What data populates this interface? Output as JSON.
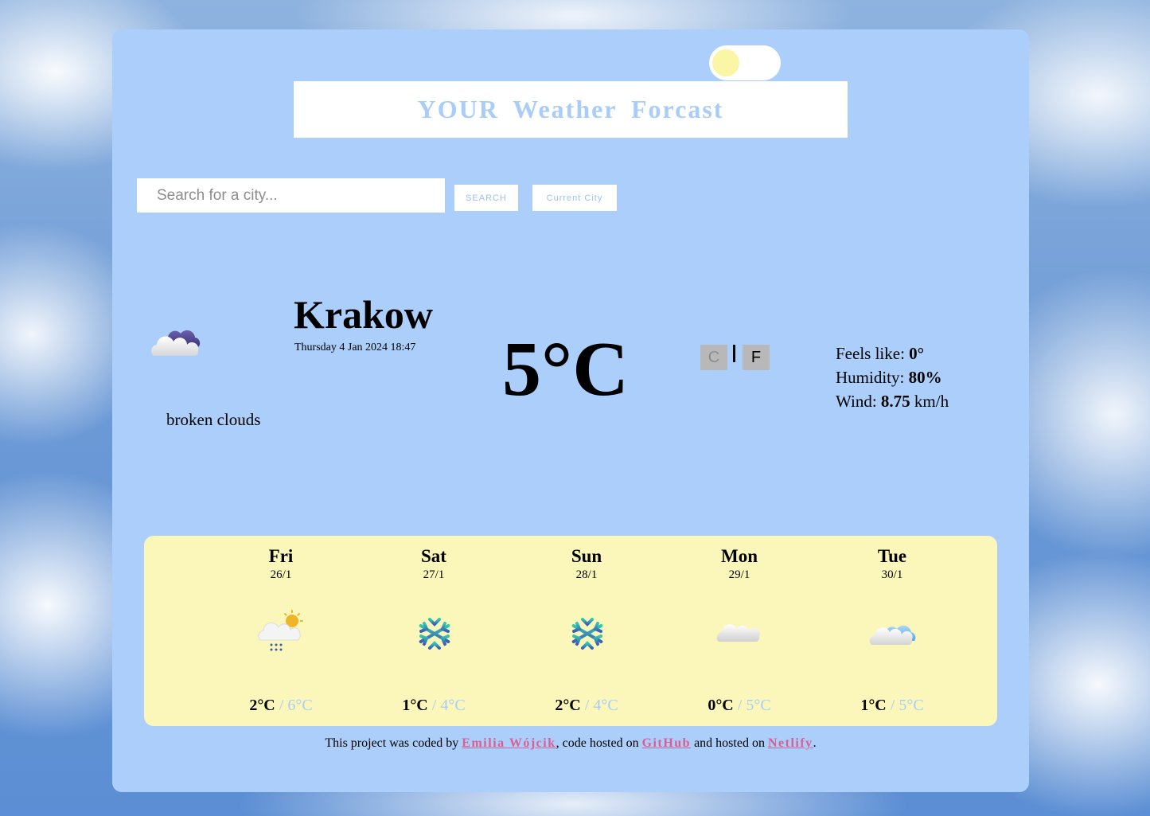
{
  "header": {
    "title": "YOUR  Weather  Forcast"
  },
  "search": {
    "placeholder": "Search for a city...",
    "search_label": "SEARCH",
    "current_city_label": "Current City"
  },
  "current": {
    "icon": "broken-clouds-icon",
    "description": "broken clouds",
    "city": "Krakow",
    "datetime": "Thursday 4 Jan 2024 18:47",
    "temperature": "5°C",
    "unit_c": "C",
    "unit_f": "F",
    "feels_label": "Feels like: ",
    "feels_value": "0°",
    "humidity_label": "Humidity: ",
    "humidity_value": "80%",
    "wind_label": "Wind: ",
    "wind_value": "8.75",
    "wind_unit": " km/h"
  },
  "forecast": [
    {
      "day": "Fri",
      "date": "26/1",
      "icon": "rain-sun-icon",
      "min": "2°C",
      "sep": " / ",
      "max": "6°C"
    },
    {
      "day": "Sat",
      "date": "27/1",
      "icon": "snowflake-icon",
      "min": "1°C",
      "sep": " / ",
      "max": "4°C"
    },
    {
      "day": "Sun",
      "date": "28/1",
      "icon": "snowflake-icon",
      "min": "2°C",
      "sep": " / ",
      "max": "4°C"
    },
    {
      "day": "Mon",
      "date": "29/1",
      "icon": "cloud-icon",
      "min": "0°C",
      "sep": " / ",
      "max": "5°C"
    },
    {
      "day": "Tue",
      "date": "30/1",
      "icon": "clouds-icon",
      "min": "1°C",
      "sep": " / ",
      "max": "5°C"
    }
  ],
  "footer": {
    "text1": "This project was coded by ",
    "author": "Emilia Wójcik",
    "text2": ", code hosted on ",
    "github": "GitHub",
    "text3": " and hosted on ",
    "netlify": "Netlify",
    "text4": "."
  },
  "colors": {
    "card": "#abcffa",
    "forecast_panel": "#fbf7bb",
    "accent": "#a9cdf7",
    "link": "#d95f93"
  }
}
